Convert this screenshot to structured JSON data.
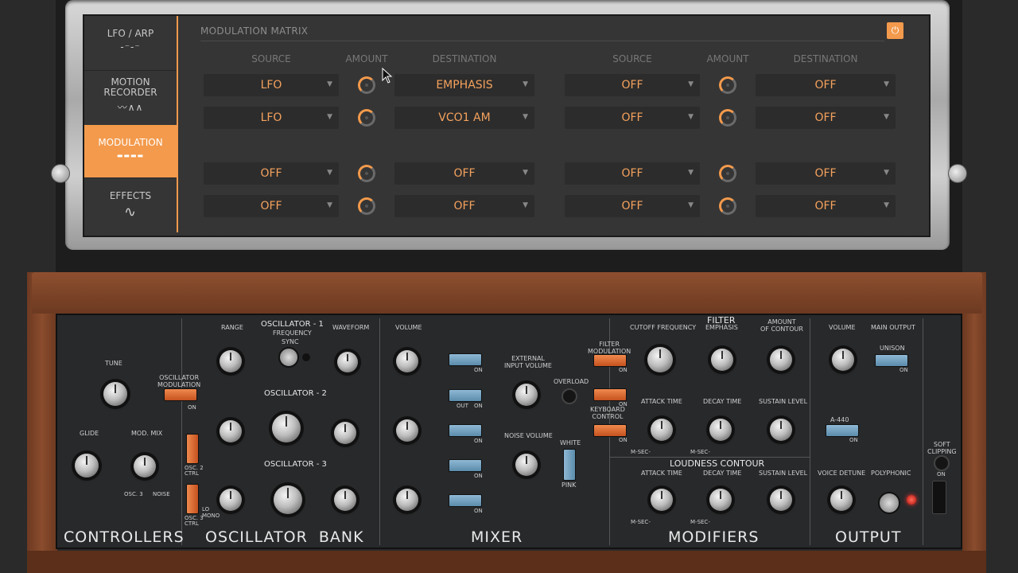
{
  "sidebar": {
    "items": [
      {
        "label": "LFO / ARP",
        "icon": "arp-icon",
        "glyph": "-⁻-⁻",
        "active": false
      },
      {
        "label": "MOTION\nRECORDER",
        "icon": "waveform-icon",
        "glyph": "〰∧∧",
        "active": false
      },
      {
        "label": "MODULATION",
        "icon": "matrix-icon",
        "glyph": "▬▬▬▬",
        "active": true
      },
      {
        "label": "EFFECTS",
        "icon": "sine-icon",
        "glyph": "∿",
        "active": false
      }
    ],
    "accent": "#f39a4c"
  },
  "matrix": {
    "title": "MODULATION MATRIX",
    "power_glyph": "⏻",
    "headers": {
      "source": "SOURCE",
      "amount": "AMOUNT",
      "destination": "DESTINATION"
    },
    "left": [
      {
        "source": "LFO",
        "destination": "EMPHASIS",
        "amount_active": true
      },
      {
        "source": "LFO",
        "destination": "VCO1 AM",
        "amount_active": true
      },
      {
        "source": "OFF",
        "destination": "OFF",
        "amount_active": true
      },
      {
        "source": "OFF",
        "destination": "OFF",
        "amount_active": true
      }
    ],
    "right": [
      {
        "source": "OFF",
        "destination": "OFF",
        "amount_active": true
      },
      {
        "source": "OFF",
        "destination": "OFF",
        "amount_active": true
      },
      {
        "source": "OFF",
        "destination": "OFF",
        "amount_active": true
      },
      {
        "source": "OFF",
        "destination": "OFF",
        "amount_active": true
      }
    ],
    "caret": "▼"
  },
  "synth": {
    "sections": {
      "controllers": "CONTROLLERS",
      "oscillator_bank": "OSCILLATOR  BANK",
      "mixer": "MIXER",
      "modifiers": "MODIFIERS",
      "output": "OUTPUT"
    },
    "controllers": {
      "tune": "TUNE",
      "osc_mod": "OSCILLATOR\nMODULATION",
      "on": "ON",
      "glide": "GLIDE",
      "mod_mix": "MOD. MIX",
      "osc2_ctrl": "OSC. 2\nCTRL",
      "osc3_ctrl": "OSC. 3\nCTRL",
      "osc3": "OSC. 3",
      "noise": "NOISE"
    },
    "osc_bank": {
      "range": "RANGE",
      "osc1": "OSCILLATOR - 1",
      "frequency": "FREQUENCY",
      "sync": "SYNC",
      "waveform": "WAVEFORM",
      "osc2": "OSCILLATOR - 2",
      "osc3": "OSCILLATOR - 3",
      "lo": "LO",
      "mono": "MONO"
    },
    "mixer": {
      "volume": "VOLUME",
      "ext_input": "EXTERNAL\nINPUT VOLUME",
      "overload": "OVERLOAD",
      "noise_volume": "NOISE VOLUME",
      "white": "WHITE",
      "pink": "PINK",
      "on": "ON",
      "out": "OUT"
    },
    "modifiers": {
      "filter": "FILTER",
      "filter_mod": "FILTER\nMODULATION",
      "cutoff": "CUTOFF  FREQUENCY",
      "emphasis": "EMPHASIS",
      "amount_contour": "AMOUNT\nOF CONTOUR",
      "keyboard_control": "KEYBOARD\nCONTROL",
      "attack": "ATTACK TIME",
      "decay": "DECAY TIME",
      "sustain": "SUSTAIN LEVEL",
      "loudness": "LOUDNESS CONTOUR",
      "msec": "M-SEC-"
    },
    "output": {
      "volume": "VOLUME",
      "main_output": "MAIN OUTPUT",
      "unison": "UNISON",
      "a440": "A-440",
      "voice_detune": "VOICE DETUNE",
      "polyphonic": "POLYPHONIC",
      "soft_clipping": "SOFT\nCLIPPING",
      "on": "ON"
    }
  }
}
